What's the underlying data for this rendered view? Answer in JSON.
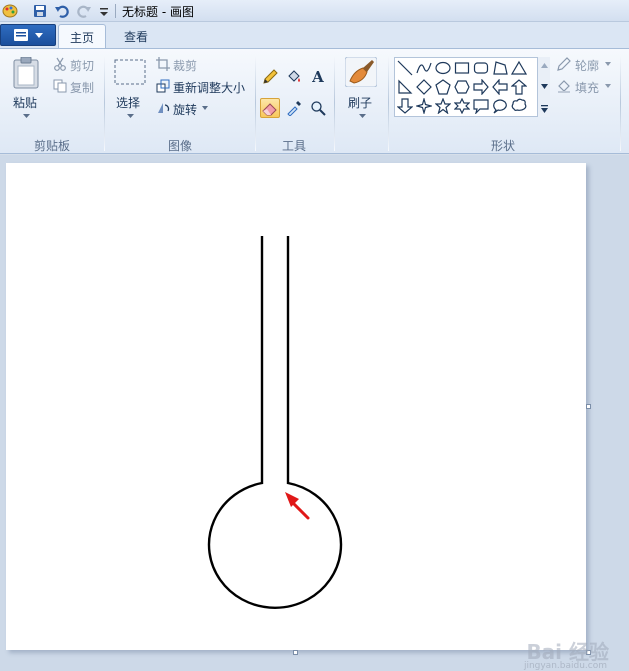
{
  "window": {
    "title": "无标题 - 画图"
  },
  "tabs": [
    {
      "label": "主页",
      "active": true
    },
    {
      "label": "查看",
      "active": false
    }
  ],
  "clipboard": {
    "paste_label": "粘贴",
    "cut_label": "剪切",
    "copy_label": "复制",
    "group_label": "剪贴板"
  },
  "image": {
    "select_label": "选择",
    "crop_label": "裁剪",
    "resize_label": "重新调整大小",
    "rotate_label": "旋转",
    "group_label": "图像"
  },
  "tools": {
    "group_label": "工具",
    "text_glyph": "A",
    "active_tool": "eraser"
  },
  "brushes": {
    "label": "刷子"
  },
  "shapes": {
    "outline_label": "轮廓",
    "fill_label": "填充",
    "group_label": "形状"
  },
  "watermark": {
    "main": "Bai 经验",
    "sub": "jingyan.baidu.com"
  },
  "colors": {
    "accent": "#1b4f9c",
    "arrow": "#e01818",
    "stroke": "#000000"
  }
}
